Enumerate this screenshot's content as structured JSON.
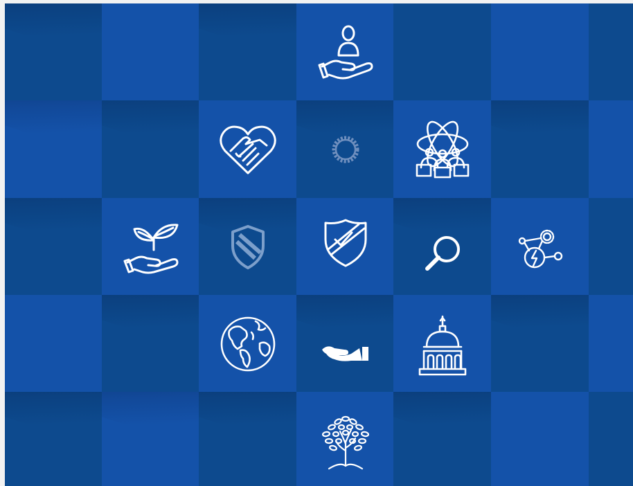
{
  "palette": {
    "dark": "#0d4a8e",
    "bright": "#1452a9",
    "mid": "#11509d",
    "icon": "#ffffff",
    "icon_faded": "#7c9fcb",
    "frame": "#f2f2f2"
  },
  "icons": [
    "person-in-hand-icon",
    "heart-handshake-icon",
    "gear-icon",
    "atom-team-icon",
    "plant-in-hand-icon",
    "faded-shield-icon",
    "shield-check-icon",
    "magnifying-glass-icon",
    "energy-network-icon",
    "globe-icon",
    "open-hand-icon",
    "capitol-building-icon",
    "tree-icon"
  ]
}
